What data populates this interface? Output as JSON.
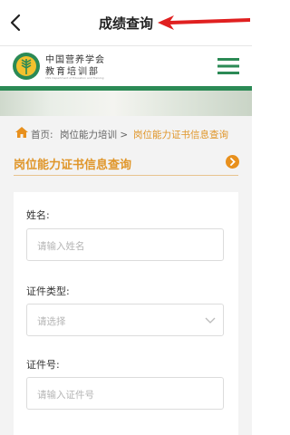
{
  "nav": {
    "title": "成绩查询"
  },
  "brand": {
    "org_line1": "中国营养学会",
    "org_line2": "教育培训部",
    "org_line3": "CNS Department of Education and Training"
  },
  "breadcrumb": {
    "home": "首页:",
    "level1": "岗位能力培训 >",
    "current": "岗位能力证书信息查询"
  },
  "section": {
    "title": "岗位能力证书信息查询"
  },
  "form": {
    "name_label": "姓名:",
    "name_placeholder": "请输入姓名",
    "idtype_label": "证件类型:",
    "idtype_value": "请选择",
    "idno_label": "证件号:",
    "idno_placeholder": "请输入证件号"
  },
  "colors": {
    "accent": "#e0962a",
    "brand_green": "#2b8a55",
    "arrow_red": "#e02020"
  },
  "icons": [
    "back-icon",
    "red-arrow-annotation",
    "emblem-logo",
    "hamburger-menu-icon",
    "home-icon",
    "go-arrow-icon",
    "chevron-down-icon"
  ]
}
